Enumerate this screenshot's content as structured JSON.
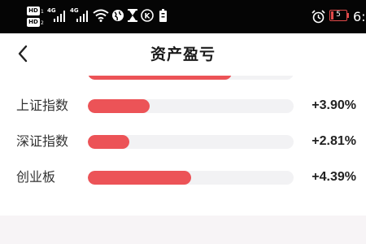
{
  "status_bar": {
    "hd1": "HD",
    "hd1_sub": "1",
    "hd2": "HD",
    "hd2_sub": "2",
    "signal1_label": "4G",
    "signal2_label": "4G",
    "battery_level": "5",
    "time": "6:",
    "icons": [
      "wifi-icon",
      "globe-icon",
      "hourglass-icon",
      "k-badge-icon",
      "battery-saver-icon",
      "alarm-icon"
    ],
    "battery_color": "#e24a4a"
  },
  "header": {
    "title": "资产盈亏",
    "back_icon": "chevron-left-icon"
  },
  "indices": [
    {
      "name": "",
      "change": "",
      "fill_fraction": 0.7,
      "partial": true
    },
    {
      "name": "上证指数",
      "change": "+3.90%",
      "fill_fraction": 0.3
    },
    {
      "name": "深证指数",
      "change": "+2.81%",
      "fill_fraction": 0.2
    },
    {
      "name": "创业板",
      "change": "+4.39%",
      "fill_fraction": 0.5
    }
  ],
  "colors": {
    "bar_fill": "#ec5357",
    "bar_track": "#f2f2f4",
    "status_bar_bg": "#050505",
    "footer_band": "#f7f4f6"
  }
}
